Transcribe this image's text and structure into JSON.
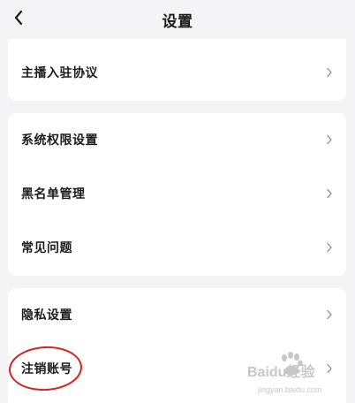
{
  "header": {
    "title": "设置",
    "back_icon": "chevron-left-icon"
  },
  "groups": [
    {
      "items": [
        {
          "label": "主播入驻协议",
          "icon": "chevron-right-icon"
        }
      ]
    },
    {
      "items": [
        {
          "label": "系统权限设置",
          "icon": "chevron-right-icon"
        },
        {
          "label": "黑名单管理",
          "icon": "chevron-right-icon"
        },
        {
          "label": "常见问题",
          "icon": "chevron-right-icon"
        }
      ]
    },
    {
      "items": [
        {
          "label": "隐私设置",
          "icon": "chevron-right-icon"
        },
        {
          "label": "注销账号",
          "icon": "chevron-right-icon"
        }
      ]
    }
  ],
  "annotation": {
    "ring_color": "#d8201e"
  },
  "watermark": {
    "text": "Baidu经验",
    "subtext": "jingyan.baidu.com"
  },
  "colors": {
    "background": "#f4f4f6",
    "card": "#ffffff",
    "text": "#1c1c1c",
    "chevron": "#8a8a8a"
  }
}
